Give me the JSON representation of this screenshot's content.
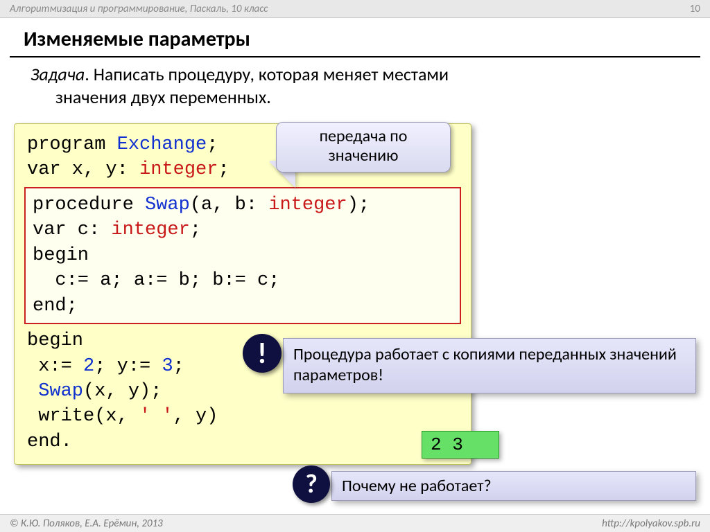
{
  "header": {
    "course": "Алгоритмизация и программирование, Паскаль, 10 класс",
    "page": "10"
  },
  "title": "Изменяемые параметры",
  "task": {
    "label": "Задача",
    "text1": ". Написать процедуру, которая меняет местами",
    "text2": "значения двух переменных."
  },
  "code": {
    "l1a": "program ",
    "l1b": "Exchange",
    "l1c": ";",
    "l2a": "var x, y: ",
    "l2b": "integer",
    "l2c": ";",
    "p1a": "procedure ",
    "p1b": "Swap",
    "p1c": "(a, b: ",
    "p1d": "integer",
    "p1e": ");",
    "p2a": "var c: ",
    "p2b": "integer",
    "p2c": ";",
    "p3": "begin",
    "p4a": "  c:= a; a:= b; b:= c;",
    "p5": "end;",
    "m1": "begin",
    "m2a": " x:= ",
    "m2b": "2",
    "m2c": "; y:= ",
    "m2d": "3",
    "m2e": ";",
    "m3a": " ",
    "m3b": "Swap",
    "m3c": "(x, y);",
    "m4a": " write(x, ",
    "m4b": "' '",
    "m4c": ", y)",
    "m5": "end."
  },
  "callout": "передача по значению",
  "info": "Процедура работает с копиями переданных значений параметров!",
  "output": "2 3",
  "question": "Почему не работает?",
  "bang": "!",
  "qmark": "?",
  "footer": {
    "left": "© К.Ю. Поляков, Е.А. Ерёмин, 2013",
    "right": "http://kpolyakov.spb.ru"
  }
}
